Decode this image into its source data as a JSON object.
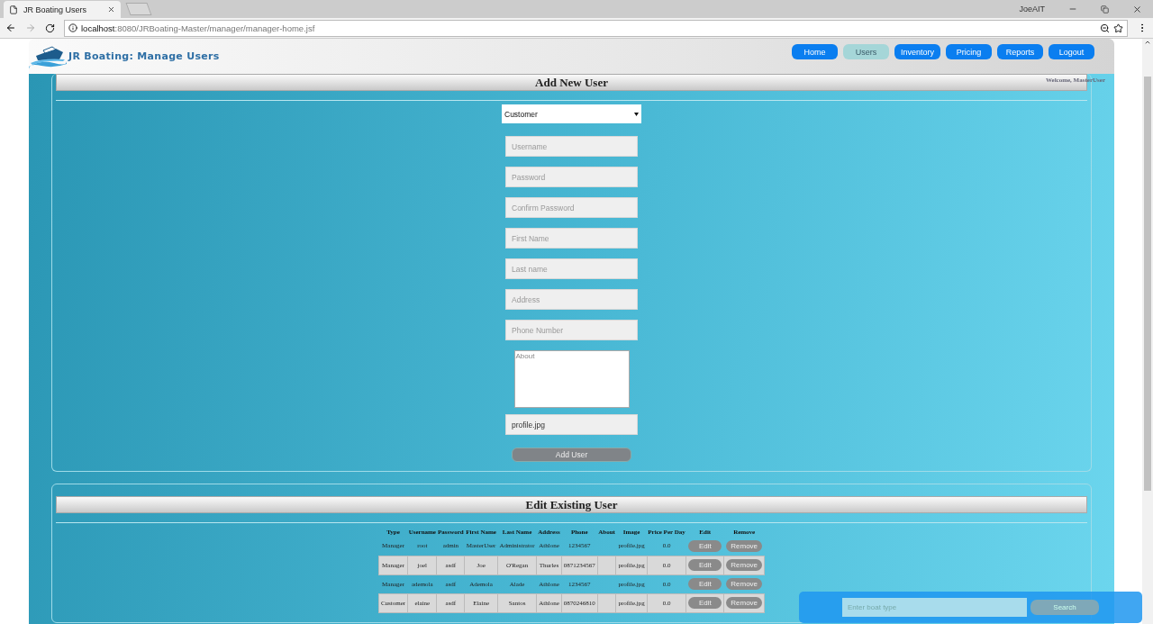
{
  "browser": {
    "tab_title": "JR Boating Users",
    "profile": "JoeAIT",
    "url_host": "localhost",
    "url_rest": ":8080/JRBoating-Master/manager/manager-home.jsf"
  },
  "header": {
    "title": "JR Boating: Manage Users",
    "welcome": "Welcome, MasterUser",
    "nav": [
      {
        "label": "Home",
        "selected": false
      },
      {
        "label": "Users",
        "selected": true
      },
      {
        "label": "Inventory",
        "selected": false
      },
      {
        "label": "Pricing",
        "selected": false
      },
      {
        "label": "Reports",
        "selected": false
      },
      {
        "label": "Logout",
        "selected": false
      }
    ]
  },
  "add_user": {
    "title": "Add New User",
    "user_type": "Customer",
    "fields": [
      {
        "placeholder": "Username"
      },
      {
        "placeholder": "Password"
      },
      {
        "placeholder": "Confirm Password"
      },
      {
        "placeholder": "First Name"
      },
      {
        "placeholder": "Last name"
      },
      {
        "placeholder": "Address"
      },
      {
        "placeholder": "Phone Number"
      }
    ],
    "about_placeholder": "About",
    "image_value": "profile.jpg",
    "submit": "Add User"
  },
  "edit_users": {
    "title": "Edit Existing User",
    "columns": [
      "Type",
      "Username",
      "Password",
      "First Name",
      "Last Name",
      "Address",
      "Phone",
      "About",
      "Image",
      "Price Per Day",
      "Edit",
      "Remove"
    ],
    "rows": [
      {
        "cells": [
          "Manager",
          "root",
          "admin",
          "MasterUser",
          "Administrator",
          "Athlone",
          "1234567",
          "",
          "profile.jpg",
          "0.0"
        ],
        "edit": "Edit",
        "remove": "Remove"
      },
      {
        "cells": [
          "Manager",
          "joel",
          "asdf",
          "Joe",
          "O'Regan",
          "Thurles",
          "0871234567",
          "",
          "profile.jpg",
          "0.0"
        ],
        "edit": "Edit",
        "remove": "Remove"
      },
      {
        "cells": [
          "Manager",
          "ademola",
          "asdf",
          "Ademola",
          "Alade",
          "Athlone",
          "1234567",
          "",
          "profile.jpg",
          "0.0"
        ],
        "edit": "Edit",
        "remove": "Remove"
      },
      {
        "cells": [
          "Customer",
          "elaine",
          "asdf",
          "Elaine",
          "Santos",
          "Athlone",
          "0870246810",
          "",
          "profile.jpg",
          "0.0"
        ],
        "edit": "Edit",
        "remove": "Remove"
      }
    ]
  },
  "search": {
    "placeholder": "Enter boat type",
    "button": "Search"
  }
}
